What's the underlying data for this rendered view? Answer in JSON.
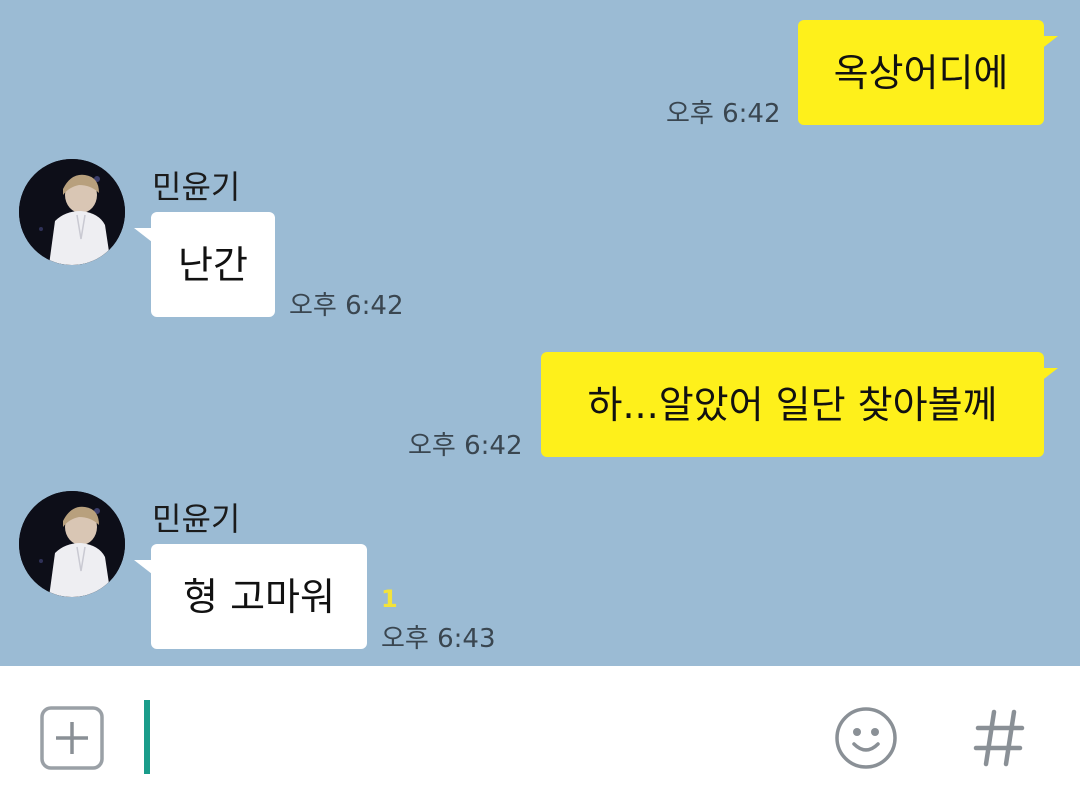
{
  "messages": [
    {
      "id": "m1",
      "side": "me",
      "text": "옥상어디에",
      "time": "오후 6:42"
    },
    {
      "id": "m2",
      "side": "other",
      "sender": "민윤기",
      "text": "난간",
      "time": "오후 6:42"
    },
    {
      "id": "m3",
      "side": "me",
      "text": "하...알았어 일단 찾아볼께",
      "time": "오후 6:42"
    },
    {
      "id": "m4",
      "side": "other",
      "sender": "민윤기",
      "text": "형 고마워",
      "time": "오후 6:43",
      "unread": "1"
    }
  ],
  "composer": {
    "add_icon": "plus-square-icon",
    "emoji_icon": "smiley-icon",
    "hashtag_icon": "hash-icon"
  },
  "colors": {
    "chat_background": "#9bbbd4",
    "my_bubble": "#fef01b",
    "their_bubble": "#ffffff",
    "cursor": "#1a9c8a",
    "unread": "#f3e33b"
  }
}
